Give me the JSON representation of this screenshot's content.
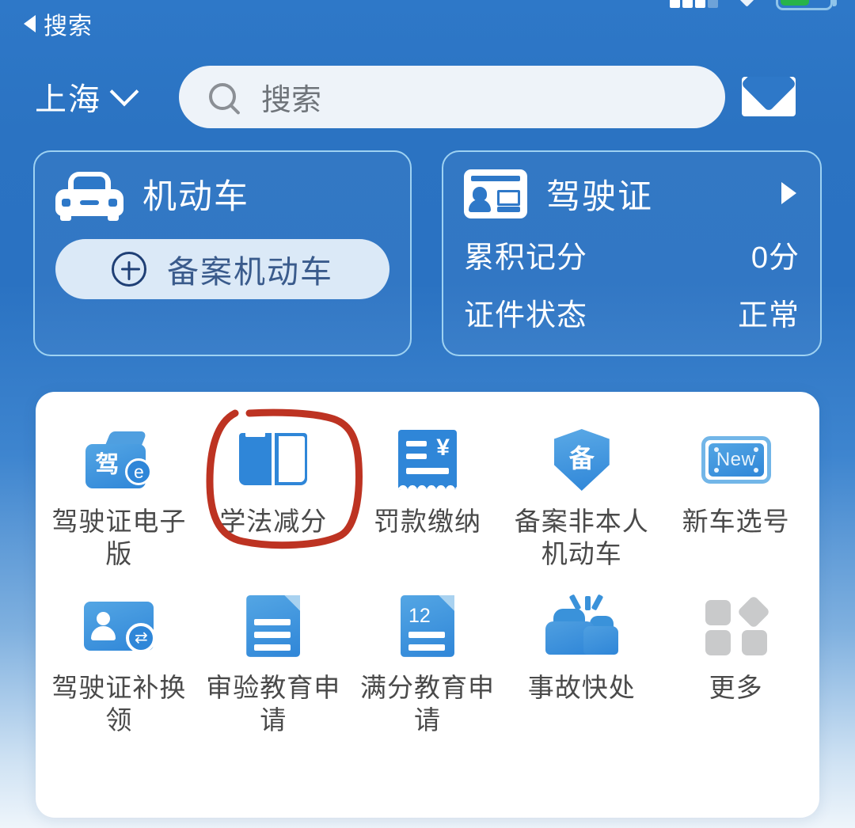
{
  "status_bar": {
    "signal_icon": "signal-bars-icon",
    "bluetooth_icon": "bluetooth-diamond-icon",
    "battery_icon": "battery-icon"
  },
  "nav": {
    "back_icon": "back-triangle-icon",
    "back_label": "搜索"
  },
  "header": {
    "city": "上海",
    "city_chevron_icon": "chevron-down-icon",
    "search": {
      "icon": "search-icon",
      "placeholder": "搜索",
      "value": ""
    },
    "mail_icon": "envelope-icon"
  },
  "cards": {
    "vehicle": {
      "icon": "car-icon",
      "title": "机动车",
      "action_icon": "plus-circle-icon",
      "action_label": "备案机动车"
    },
    "license": {
      "icon": "id-card-icon",
      "title": "驾驶证",
      "arrow_icon": "chevron-right-icon",
      "rows": [
        {
          "label": "累积记分",
          "value": "0分"
        },
        {
          "label": "证件状态",
          "value": "正常"
        }
      ]
    }
  },
  "grid": {
    "items": [
      {
        "icon": "license-wallet-icon",
        "label": "驾驶证电子版",
        "badge_text": "驾",
        "badge_sub": "e",
        "highlighted": false
      },
      {
        "icon": "open-book-icon",
        "label": "学法减分",
        "highlighted": true
      },
      {
        "icon": "receipt-yen-icon",
        "label": "罚款缴纳",
        "badge_text": "¥",
        "highlighted": false
      },
      {
        "icon": "shield-record-icon",
        "label": "备案非本人机动车",
        "badge_text": "备",
        "highlighted": false
      },
      {
        "icon": "license-plate-new-icon",
        "label": "新车选号",
        "badge_text": "New",
        "highlighted": false
      },
      {
        "icon": "id-card-renew-icon",
        "label": "驾驶证补换领",
        "highlighted": false
      },
      {
        "icon": "document-icon",
        "label": "审验教育申请",
        "highlighted": false
      },
      {
        "icon": "document-12-icon",
        "label": "满分教育申请",
        "badge_text": "12",
        "highlighted": false
      },
      {
        "icon": "car-collision-icon",
        "label": "事故快处",
        "highlighted": false
      },
      {
        "icon": "more-grid-icon",
        "label": "更多",
        "highlighted": false
      }
    ]
  },
  "annotation": {
    "shape": "hand-drawn-circle",
    "color": "#bd3322",
    "target_label": "学法减分"
  },
  "colors": {
    "background_top": "#2e78c8",
    "background_bottom": "#eef5fb",
    "panel": "#ffffff",
    "icon_blue": "#2f86d8",
    "pill_bg": "#dbe9f7",
    "annotation_red": "#bd3322"
  }
}
